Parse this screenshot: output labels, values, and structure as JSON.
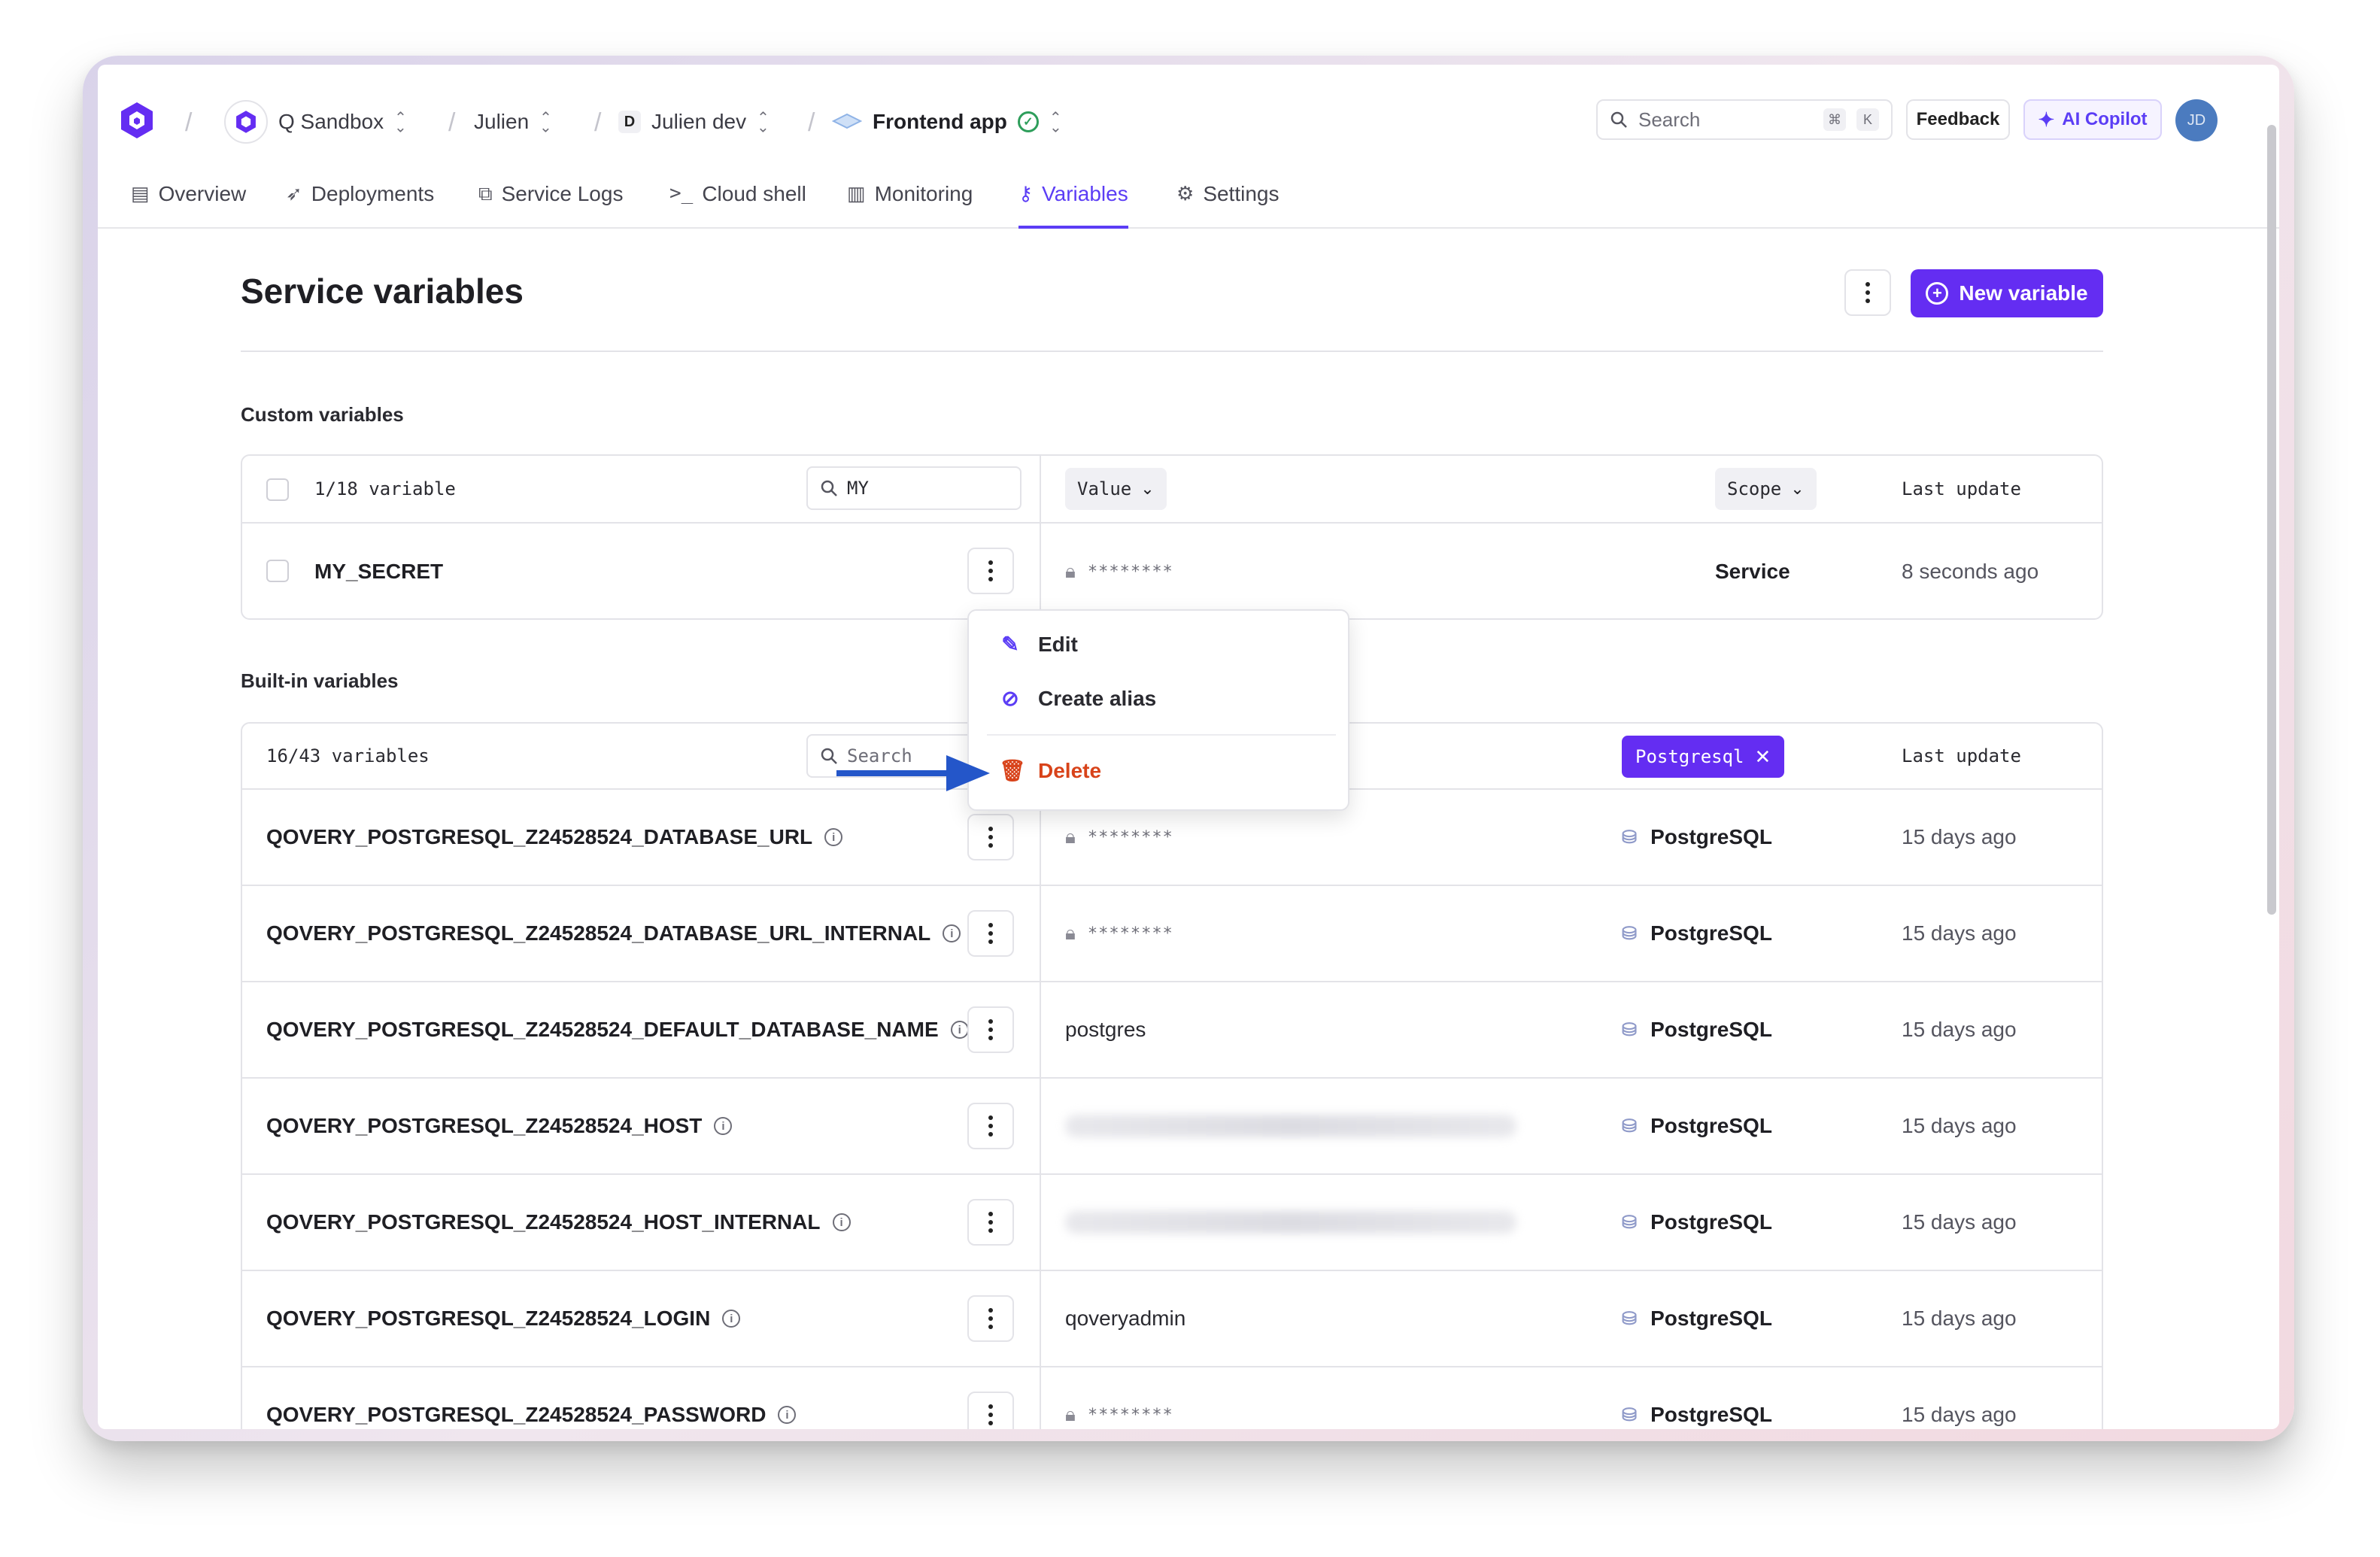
{
  "breadcrumb": {
    "org": "Q Sandbox",
    "project": "Julien",
    "env_badge": "D",
    "environment": "Julien dev",
    "service": "Frontend app"
  },
  "topbar": {
    "search_placeholder": "Search",
    "shortcut_cmd": "⌘",
    "shortcut_key": "K",
    "feedback": "Feedback",
    "copilot": "AI Copilot",
    "user_initials": "JD"
  },
  "tabs": [
    {
      "label": "Overview",
      "icon": "layout-icon"
    },
    {
      "label": "Deployments",
      "icon": "rocket-icon"
    },
    {
      "label": "Service Logs",
      "icon": "logs-icon"
    },
    {
      "label": "Cloud shell",
      "icon": "terminal-icon"
    },
    {
      "label": "Monitoring",
      "icon": "chart-icon"
    },
    {
      "label": "Variables",
      "icon": "key-icon",
      "active": true
    },
    {
      "label": "Settings",
      "icon": "gear-icon"
    }
  ],
  "page": {
    "title": "Service variables",
    "new_variable": "New variable"
  },
  "custom": {
    "section_title": "Custom variables",
    "count": "1/18 variable",
    "filter_value": "MY",
    "value_header": "Value",
    "scope_header": "Scope",
    "last_update_header": "Last update",
    "rows": [
      {
        "name": "MY_SECRET",
        "value": "********",
        "scope": "Service",
        "updated": "8 seconds ago"
      }
    ]
  },
  "context_menu": {
    "edit": "Edit",
    "create_alias": "Create alias",
    "delete": "Delete"
  },
  "builtin": {
    "section_title": "Built-in variables",
    "count": "16/43 variables",
    "search_placeholder": "Search",
    "scope_filter": "Postgresql",
    "last_update_header": "Last update",
    "rows": [
      {
        "name": "QOVERY_POSTGRESQL_Z24528524_DATABASE_URL",
        "value": "********",
        "scope": "PostgreSQL",
        "updated": "15 days ago"
      },
      {
        "name": "QOVERY_POSTGRESQL_Z24528524_DATABASE_URL_INTERNAL",
        "value": "********",
        "scope": "PostgreSQL",
        "updated": "15 days ago"
      },
      {
        "name": "QOVERY_POSTGRESQL_Z24528524_DEFAULT_DATABASE_NAME",
        "value": "postgres",
        "scope": "PostgreSQL",
        "updated": "15 days ago"
      },
      {
        "name": "QOVERY_POSTGRESQL_Z24528524_HOST",
        "value": "",
        "scope": "PostgreSQL",
        "updated": "15 days ago"
      },
      {
        "name": "QOVERY_POSTGRESQL_Z24528524_HOST_INTERNAL",
        "value": "",
        "scope": "PostgreSQL",
        "updated": "15 days ago"
      },
      {
        "name": "QOVERY_POSTGRESQL_Z24528524_LOGIN",
        "value": "qoveryadmin",
        "scope": "PostgreSQL",
        "updated": "15 days ago"
      },
      {
        "name": "QOVERY_POSTGRESQL_Z24528524_PASSWORD",
        "value": "********",
        "scope": "PostgreSQL",
        "updated": "15 days ago"
      }
    ]
  },
  "colors": {
    "accent": "#642df2",
    "danger": "#d8431a",
    "annotation_arrow": "#2456c9"
  }
}
